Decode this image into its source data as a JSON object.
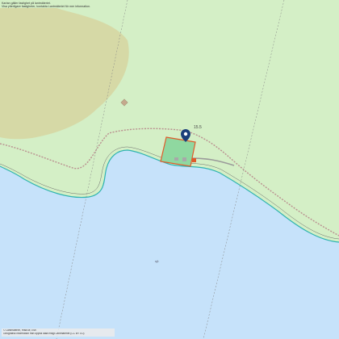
{
  "notice": {
    "line1": "Kartan gäller fastighet på lantmäteriet.",
    "line2": "Visa ytterligare fastigheter, kontakta Lantmäteriet för mer information."
  },
  "map_labels": {
    "elevation": "15.5",
    "water_small": "sjö"
  },
  "footer": {
    "line1": "© Lantmäteriet, Hitta.se, Esri",
    "line2": "Geografisk information från öppna data enligt Lantmäteriet (CC BY 4.0)"
  },
  "colors": {
    "water": "#c6e2fa",
    "land": "#d4efc6",
    "forest": "#d6d9a6",
    "parcel_fill": "#8fd8a0",
    "parcel_border": "#e05a2a",
    "marker": "#1b3f7a",
    "shoreline": "#2fb4b0",
    "road": "#b98f8f",
    "grid": "#888888"
  },
  "marker": {
    "icon": "map-pin-icon"
  }
}
